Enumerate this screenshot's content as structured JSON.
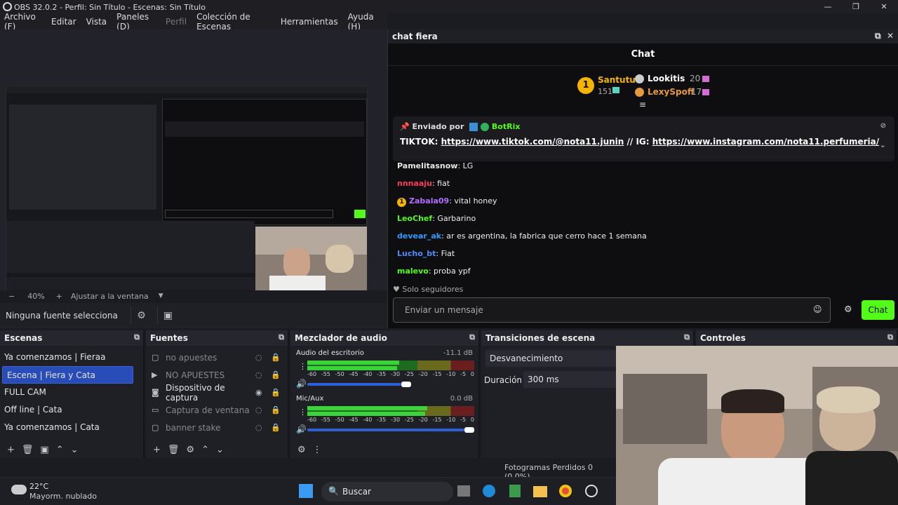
{
  "window": {
    "title": "OBS 32.0.2 - Perfil: Sin Título - Escenas: Sin Título"
  },
  "menu": [
    "Archivo (F)",
    "Editar",
    "Vista",
    "Paneles (D)",
    "Perfil",
    "Colección de Escenas",
    "Herramientas",
    "Ayuda (H)"
  ],
  "zoom": {
    "minus": "−",
    "value": "40%",
    "plus": "+",
    "fit": "Ajustar a la ventana"
  },
  "no_source": "Ninguna fuente selecciona",
  "chat_dock": {
    "title": "chat fiera",
    "header": "Chat",
    "gifters": [
      {
        "name": "Santutu",
        "count": "151",
        "rank": "1"
      },
      {
        "name": "Lookitis",
        "count": "20"
      },
      {
        "name": "LexySpoff",
        "count": "17"
      }
    ],
    "pinned": {
      "by_label": "Enviado por",
      "by_user": "BotRix",
      "text_prefix": "TIKTOK: ",
      "link1": "https://www.tiktok.com/@nota11.junin",
      "sep": " // IG: ",
      "link2": "https://www.instagram.com/nota11.perfumeria/"
    },
    "messages": [
      {
        "user": "Pamelitasnow",
        "text": ": LG",
        "color": "#e8e8e8"
      },
      {
        "user": "nnnaaju",
        "text": ": fiat",
        "color": "#ff3b5c"
      },
      {
        "user": "Zabala09",
        "text": ": vital honey",
        "color": "#b66cff",
        "badge": "1"
      },
      {
        "user": "LeoChef",
        "text": ": Garbarino",
        "color": "#53fc18"
      },
      {
        "user": "devear_ak",
        "text": ": ar es argentina, la fabrica que cerro hace 1 semana",
        "color": "#2b9bff"
      },
      {
        "user": "Lucho_bt",
        "text": ": Fiat",
        "color": "#4f8cff"
      },
      {
        "user": "malevo",
        "text": ": proba ypf",
        "color": "#53fc18"
      }
    ],
    "followers_only": "Solo seguidores",
    "input_placeholder": "Enviar un mensaje",
    "send_label": "Chat"
  },
  "scenes": {
    "title": "Escenas",
    "items": [
      "Ya comenzamos | Fieraa",
      "Escena | Fiera y Cata",
      "FULL CAM",
      "Off line | Cata",
      "Ya comenzamos | Cata"
    ]
  },
  "sources": {
    "title": "Fuentes",
    "items": [
      {
        "name": "no apuestes",
        "visible": false
      },
      {
        "name": "NO APUESTES",
        "visible": false
      },
      {
        "name": "Dispositivo de captura",
        "visible": true
      },
      {
        "name": "Captura de ventana",
        "visible": false
      },
      {
        "name": "banner stake",
        "visible": false
      }
    ]
  },
  "mixer": {
    "title": "Mezclador de audio",
    "channels": [
      {
        "name": "Audio del escritorio",
        "db": "-11.1 dB",
        "level": 0.55,
        "volume": 0.6
      },
      {
        "name": "Mic/Aux",
        "db": "0.0 dB",
        "level": 0.72,
        "volume": 1.0
      }
    ],
    "ticks": [
      "-60",
      "-55",
      "-50",
      "-45",
      "-40",
      "-35",
      "-30",
      "-25",
      "-20",
      "-15",
      "-10",
      "-5",
      "0"
    ]
  },
  "transitions": {
    "title": "Transiciones de escena",
    "type": "Desvanecimiento",
    "duration_label": "Duración",
    "duration": "300 ms"
  },
  "controls": {
    "title": "Controles"
  },
  "status": {
    "frames": "Fotogramas Perdidos 0 (0.0%)"
  },
  "taskbar": {
    "temp": "22°C",
    "weather": "Mayorm. nublado",
    "search": "Buscar"
  },
  "colors": {
    "kick_green": "#53fc18",
    "selection": "#284cb8"
  }
}
